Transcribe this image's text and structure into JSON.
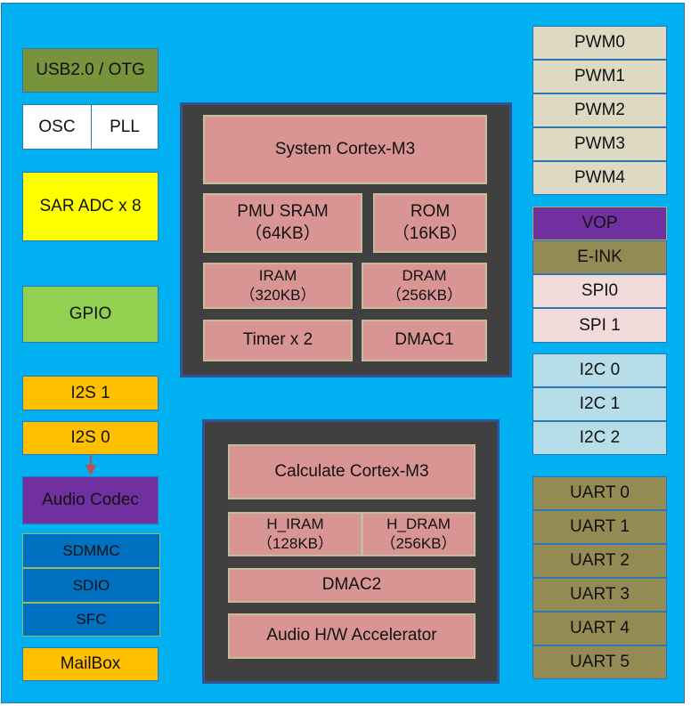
{
  "colors": {
    "background": "#00B0F0",
    "core_frame": "#404040",
    "core_cell": "#D99594",
    "arrow": "#C0504D"
  },
  "left": [
    {
      "label": "USB2.0 / OTG",
      "color": "#77933C"
    },
    {
      "label": "OSC",
      "color": "#FFFFFF"
    },
    {
      "label": "PLL",
      "color": "#FFFFFF"
    },
    {
      "label": "SAR ADC x 8",
      "color": "#FFFF00"
    },
    {
      "label": "GPIO",
      "color": "#92D050"
    },
    {
      "label": "I2S 1",
      "color": "#FFC000"
    },
    {
      "label": "I2S 0",
      "color": "#FFC000"
    },
    {
      "label": "Audio Codec",
      "color": "#7030A0"
    },
    {
      "label": "SDMMC",
      "color": "#0070C0"
    },
    {
      "label": "SDIO",
      "color": "#0070C0"
    },
    {
      "label": "SFC",
      "color": "#0070C0"
    },
    {
      "label": "MailBox",
      "color": "#FFC000"
    }
  ],
  "system_core": [
    {
      "label": "System Cortex-M3"
    },
    {
      "label": "PMU SRAM\n（64KB）"
    },
    {
      "label": "ROM\n（16KB）"
    },
    {
      "label": "IRAM\n（320KB）"
    },
    {
      "label": "DRAM\n（256KB）"
    },
    {
      "label": "Timer x 2"
    },
    {
      "label": "DMAC1"
    }
  ],
  "calculate_core": [
    {
      "label": "Calculate Cortex-M3"
    },
    {
      "label": "H_IRAM\n（128KB）"
    },
    {
      "label": "H_DRAM\n（256KB）"
    },
    {
      "label": "DMAC2"
    },
    {
      "label": "Audio H/W Accelerator"
    }
  ],
  "right": [
    {
      "label": "PWM0",
      "color": "#DDD9C3"
    },
    {
      "label": "PWM1",
      "color": "#DDD9C3"
    },
    {
      "label": "PWM2",
      "color": "#DDD9C3"
    },
    {
      "label": "PWM3",
      "color": "#DDD9C3"
    },
    {
      "label": "PWM4",
      "color": "#DDD9C3"
    },
    {
      "label": "VOP",
      "color": "#7030A0"
    },
    {
      "label": "E-INK",
      "color": "#948A54"
    },
    {
      "label": "SPI0",
      "color": "#F2DCDB"
    },
    {
      "label": "SPI 1",
      "color": "#F2DCDB"
    },
    {
      "label": "I2C 0",
      "color": "#B7DEE8"
    },
    {
      "label": "I2C 1",
      "color": "#B7DEE8"
    },
    {
      "label": "I2C 2",
      "color": "#B7DEE8"
    },
    {
      "label": "UART 0",
      "color": "#948A54"
    },
    {
      "label": "UART 1",
      "color": "#948A54"
    },
    {
      "label": "UART 2",
      "color": "#948A54"
    },
    {
      "label": "UART 3",
      "color": "#948A54"
    },
    {
      "label": "UART 4",
      "color": "#948A54"
    },
    {
      "label": "UART 5",
      "color": "#948A54"
    }
  ]
}
